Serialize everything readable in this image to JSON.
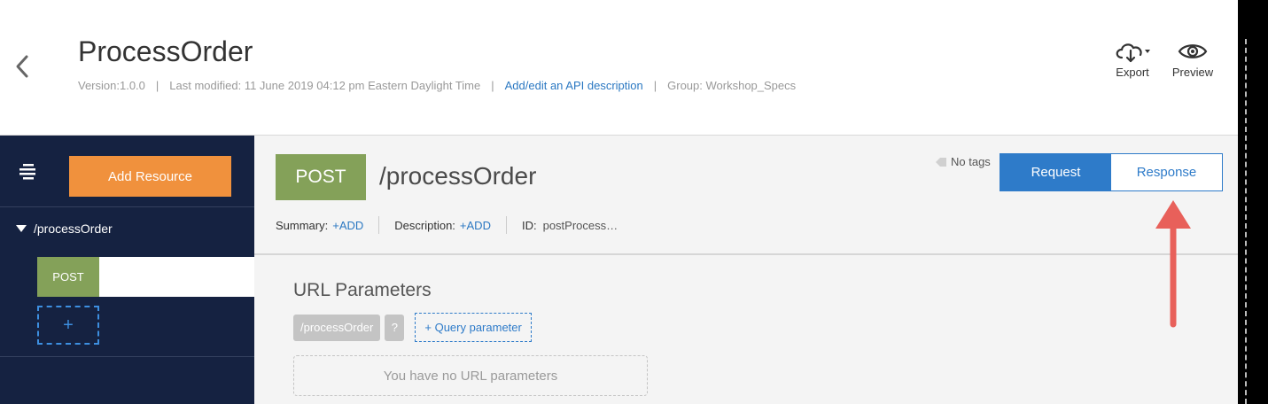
{
  "header": {
    "title": "ProcessOrder",
    "version": "Version:1.0.0",
    "last_modified": "Last modified: 11 June 2019 04:12 pm Eastern Daylight Time",
    "description_link": "Add/edit an API description",
    "group": "Group: Workshop_Specs",
    "actions": {
      "export_label": "Export",
      "preview_label": "Preview"
    }
  },
  "sidebar": {
    "add_resource_label": "Add Resource",
    "resource": "/processOrder",
    "method": "POST",
    "add_method_label": "+"
  },
  "main": {
    "method": "POST",
    "path": "/processOrder",
    "tags_label": "No tags",
    "toggle": {
      "request_label": "Request",
      "response_label": "Response",
      "active": "Request"
    },
    "summary_label": "Summary:",
    "summary_add": "+ADD",
    "description_label": "Description:",
    "description_add": "+ADD",
    "id_label": "ID:",
    "id_value": "postProcess…",
    "url_params": {
      "title": "URL Parameters",
      "path_chip": "/processOrder",
      "help_chip": "?",
      "add_query": "+ Query parameter",
      "empty_text": "You have no URL parameters"
    }
  },
  "colors": {
    "method_post": "#84a159",
    "accent_blue": "#2e7bc9",
    "add_resource": "#f0913d",
    "sidebar_bg": "#152241",
    "annotation_arrow": "#e8605a"
  },
  "icons": {
    "back": "chevron-left-icon",
    "export": "cloud-download-icon",
    "preview": "eye-icon",
    "list": "list-icon",
    "tag": "tag-icon",
    "annotation": "arrow-up-icon"
  }
}
